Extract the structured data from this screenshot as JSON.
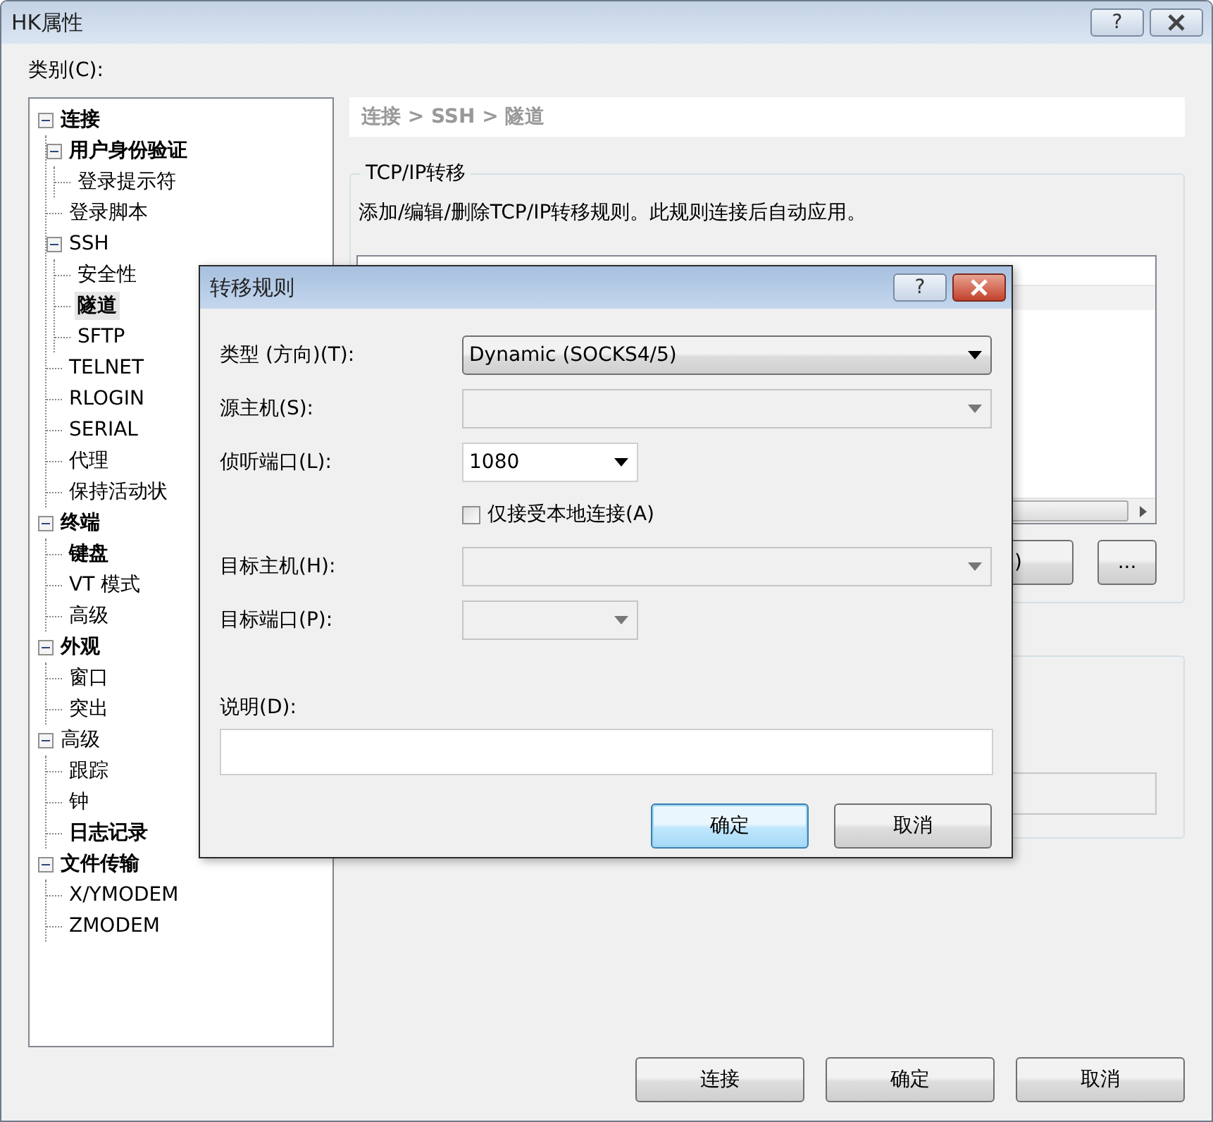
{
  "window": {
    "title": "HK属性",
    "help": "?"
  },
  "category_label": "类别(C):",
  "tree": [
    {
      "label": "连接",
      "bold": true,
      "selected": false,
      "expanded": true,
      "children": [
        {
          "label": "用户身份验证",
          "bold": true,
          "selected": false,
          "expanded": true,
          "children": [
            {
              "label": "登录提示符",
              "bold": false,
              "selected": false
            }
          ]
        },
        {
          "label": "登录脚本",
          "bold": false,
          "selected": false
        },
        {
          "label": "SSH",
          "bold": false,
          "selected": false,
          "expanded": true,
          "children": [
            {
              "label": "安全性",
              "bold": false,
              "selected": false
            },
            {
              "label": "隧道",
              "bold": true,
              "selected": true
            },
            {
              "label": "SFTP",
              "bold": false,
              "selected": false
            }
          ]
        },
        {
          "label": "TELNET",
          "bold": false,
          "selected": false
        },
        {
          "label": "RLOGIN",
          "bold": false,
          "selected": false
        },
        {
          "label": "SERIAL",
          "bold": false,
          "selected": false
        },
        {
          "label": "代理",
          "bold": false,
          "selected": false
        },
        {
          "label": "保持活动状",
          "bold": false,
          "selected": false
        }
      ]
    },
    {
      "label": "终端",
      "bold": true,
      "selected": false,
      "expanded": true,
      "children": [
        {
          "label": "键盘",
          "bold": true,
          "selected": false
        },
        {
          "label": "VT 模式",
          "bold": false,
          "selected": false
        },
        {
          "label": "高级",
          "bold": false,
          "selected": false
        }
      ]
    },
    {
      "label": "外观",
      "bold": true,
      "selected": false,
      "expanded": true,
      "children": [
        {
          "label": "窗口",
          "bold": false,
          "selected": false
        },
        {
          "label": "突出",
          "bold": false,
          "selected": false
        }
      ]
    },
    {
      "label": "高级",
      "bold": false,
      "selected": false,
      "expanded": true,
      "children": [
        {
          "label": "跟踪",
          "bold": false,
          "selected": false
        },
        {
          "label": "钟",
          "bold": false,
          "selected": false
        },
        {
          "label": "日志记录",
          "bold": true,
          "selected": false
        }
      ]
    },
    {
      "label": "文件传输",
      "bold": true,
      "selected": false,
      "expanded": true,
      "children": [
        {
          "label": "X/YMODEM",
          "bold": false,
          "selected": false
        },
        {
          "label": "ZMODEM",
          "bold": false,
          "selected": false
        }
      ]
    }
  ],
  "breadcrumb": "连接 > SSH > 隧道",
  "forwarding": {
    "title": "TCP/IP转移",
    "description": "添加/编辑/删除TCP/IP转移规则。此规则连接后自动应用。",
    "partial_button": ")",
    "more_button": "..."
  },
  "footer_buttons": [
    {
      "label": "连接",
      "default": false
    },
    {
      "label": "确定",
      "default": false
    },
    {
      "label": "取消",
      "default": false
    }
  ],
  "dialog": {
    "title": "转移规则",
    "help": "?",
    "fields": [
      {
        "kind": "dropdown",
        "label": "类型 (方向)(T):",
        "value": "Dynamic (SOCKS4/5)",
        "disabled": false
      },
      {
        "kind": "combo",
        "label": "源主机(S):",
        "disabled": true
      },
      {
        "kind": "port",
        "label": "侦听端口(L):",
        "value": "1080",
        "disabled": false
      },
      {
        "kind": "checkbox",
        "label": "仅接受本地连接(A)",
        "checked": false
      },
      {
        "kind": "combo",
        "label": "目标主机(H):",
        "disabled": true
      },
      {
        "kind": "port",
        "label": "目标端口(P):",
        "disabled": true
      }
    ],
    "description_label": "说明(D):",
    "buttons": [
      {
        "label": "确定",
        "default": true
      },
      {
        "label": "取消",
        "default": false
      }
    ]
  }
}
